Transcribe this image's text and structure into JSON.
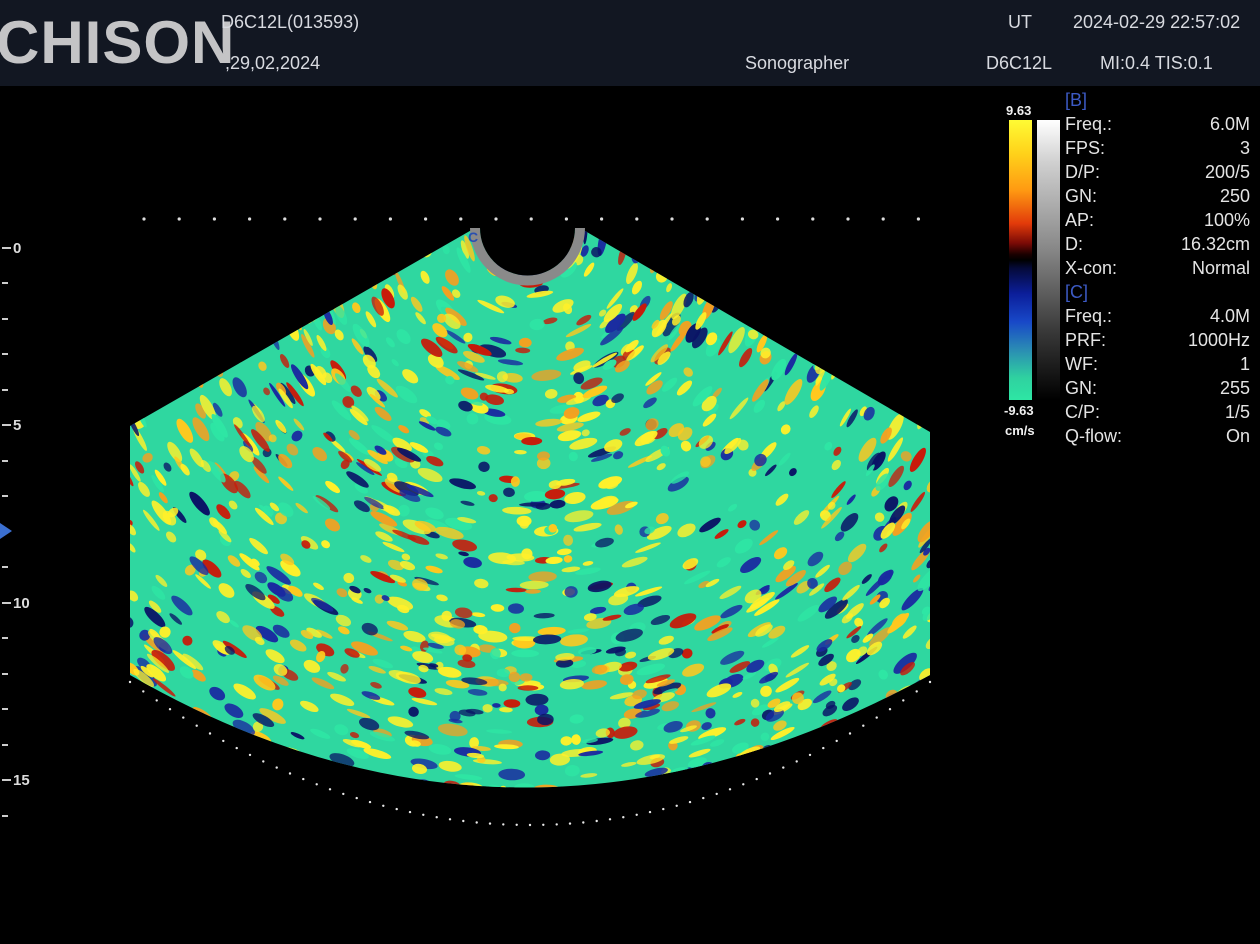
{
  "header": {
    "logo": "CHISON",
    "probe_id": "D6C12L(013593)",
    "date_short": ",29,02,2024",
    "exam": "UT",
    "datetime": "2024-02-29 22:57:02",
    "operator": "Sonographer",
    "probe": "D6C12L",
    "indices": "MI:0.4 TIS:0.1"
  },
  "depth_scale": {
    "labels": [
      "0",
      "5",
      "10",
      "15"
    ]
  },
  "colorbar": {
    "max": "9.63",
    "min": "-9.63",
    "unit": "cm/s"
  },
  "params": {
    "b_title": "[B]",
    "b": [
      {
        "key": "Freq.:",
        "value": "6.0M"
      },
      {
        "key": "FPS:",
        "value": "3"
      },
      {
        "key": "D/P:",
        "value": "200/5"
      },
      {
        "key": "GN:",
        "value": "250"
      },
      {
        "key": "AP:",
        "value": "100%"
      },
      {
        "key": "D:",
        "value": "16.32cm"
      },
      {
        "key": "X-con:",
        "value": "Normal"
      }
    ],
    "c_title": "[C]",
    "c": [
      {
        "key": "Freq.:",
        "value": "4.0M"
      },
      {
        "key": "PRF:",
        "value": "1000Hz"
      },
      {
        "key": "WF:",
        "value": "1"
      },
      {
        "key": "GN:",
        "value": "255"
      },
      {
        "key": "C/P:",
        "value": "1/5"
      },
      {
        "key": "Q-flow:",
        "value": "On"
      }
    ]
  },
  "probe_marker": "C",
  "colors": {
    "header_bg": "#121722",
    "accent_blue": "#3c5ac4",
    "doppler_green": "#2ee6a4",
    "doppler_yellow": "#fff02a",
    "doppler_red": "#c81a0a",
    "doppler_blue": "#1a2aa0"
  }
}
